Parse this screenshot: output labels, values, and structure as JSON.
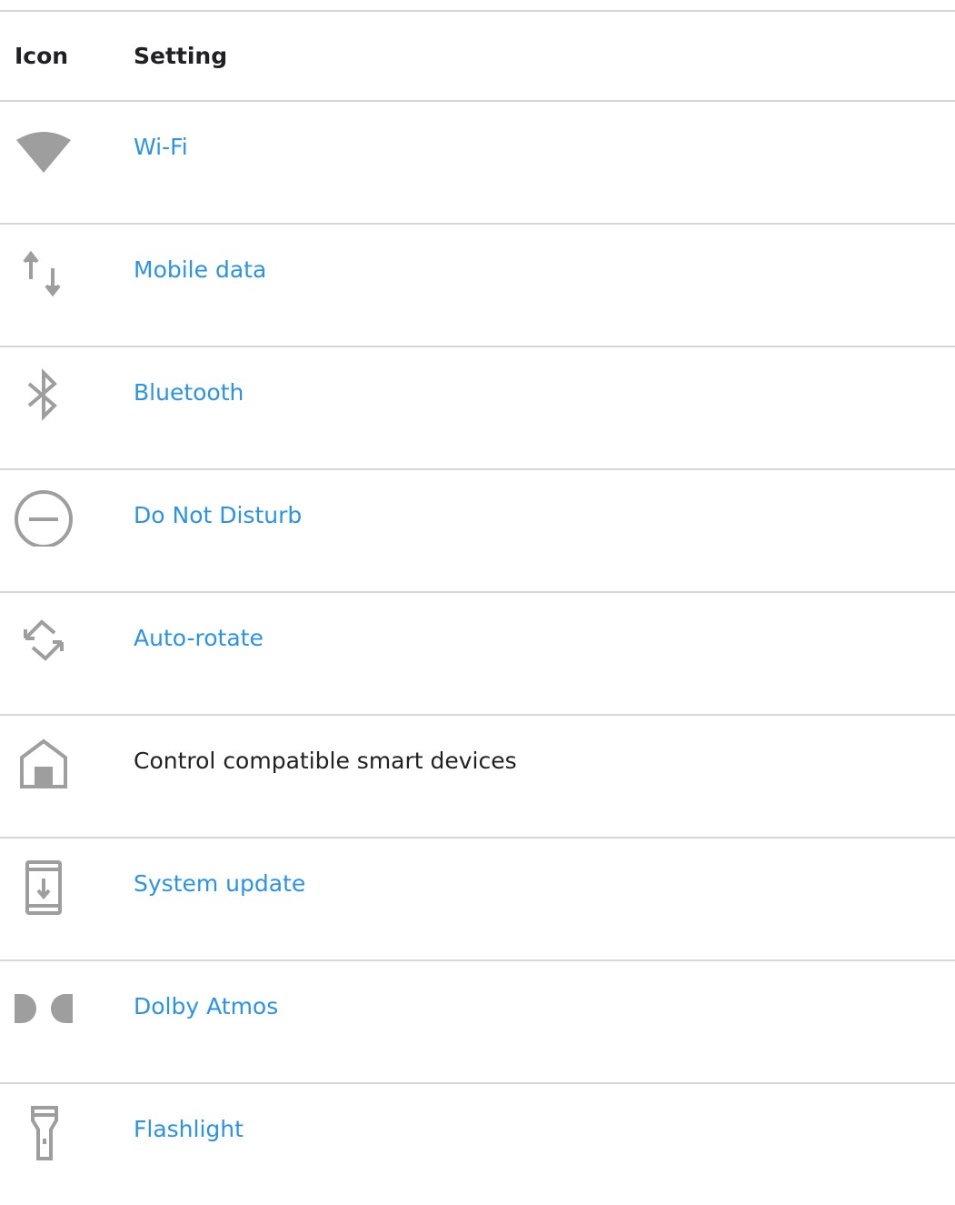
{
  "table": {
    "headers": {
      "icon": "Icon",
      "setting": "Setting"
    },
    "rows": [
      {
        "icon": "wifi-icon",
        "label": "Wi-Fi",
        "is_link": true
      },
      {
        "icon": "mobile-data-icon",
        "label": "Mobile data",
        "is_link": true
      },
      {
        "icon": "bluetooth-icon",
        "label": "Bluetooth",
        "is_link": true
      },
      {
        "icon": "do-not-disturb-icon",
        "label": "Do Not Disturb",
        "is_link": true
      },
      {
        "icon": "auto-rotate-icon",
        "label": "Auto-rotate",
        "is_link": true
      },
      {
        "icon": "home-icon",
        "label": "Control compatible smart devices",
        "is_link": false
      },
      {
        "icon": "system-update-icon",
        "label": "System update",
        "is_link": true
      },
      {
        "icon": "dolby-atmos-icon",
        "label": "Dolby Atmos",
        "is_link": true
      },
      {
        "icon": "flashlight-icon",
        "label": "Flashlight",
        "is_link": true
      }
    ]
  },
  "colors": {
    "link": "#2b93e6",
    "icon": "#9e9e9e",
    "divider": "#d6d6d6"
  }
}
